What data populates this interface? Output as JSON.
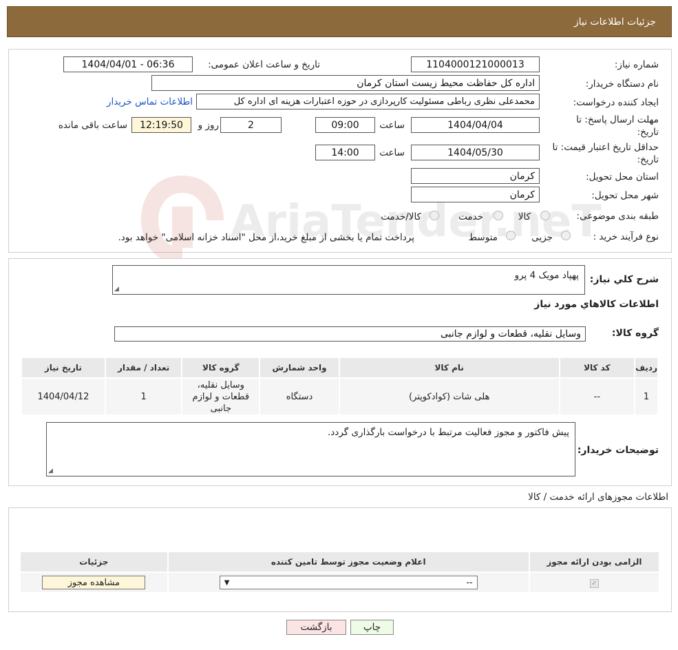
{
  "header": {
    "title": "جزئیات اطلاعات نیاز"
  },
  "form": {
    "need_number_label": "شماره نیاز:",
    "need_number": "1104000121000013",
    "announce_label": "تاریخ و ساعت اعلان عمومی:",
    "announce_value": "1404/04/01 - 06:36",
    "buyer_label": "نام دستگاه خریدار:",
    "buyer_value": "اداره کل حفاظت محیط زیست استان کرمان",
    "creator_label": "ایجاد کننده درخواست:",
    "creator_value": "محمدعلی نظری رباطی مسئولیت کارپردازی در حوزه اعتبارات هزینه ای اداره کل",
    "contact_link": "اطلاعات تماس خریدار",
    "deadline_label_1": "مهلت ارسال پاسخ: تا",
    "deadline_label_2": "تاریخ:",
    "deadline_date": "1404/04/04",
    "time_label": "ساعت",
    "deadline_time": "09:00",
    "days_value": "2",
    "days_label": "روز و",
    "remaining_time": "12:19:50",
    "remaining_label": "ساعت باقی مانده",
    "validity_label_1": "حداقل تاریخ اعتبار قیمت: تا",
    "validity_label_2": "تاریخ:",
    "validity_date": "1404/05/30",
    "validity_time": "14:00",
    "province_label": "استان محل تحویل:",
    "province_value": "کرمان",
    "city_label": "شهر محل تحویل:",
    "city_value": "کرمان",
    "category_label": "طبقه بندی موضوعی:",
    "category_options": [
      "کالا",
      "خدمت",
      "کالا/خدمت"
    ],
    "process_label": "نوع فرآیند خرید :",
    "process_options": [
      "جزیی",
      "متوسط"
    ],
    "process_note": "پرداخت تمام یا بخشی از مبلغ خرید،از محل \"اسناد خزانه اسلامی\" خواهد بود."
  },
  "details": {
    "summary_label": "شرح کلي نياز:",
    "summary_value": "پهپاد مویک 4 پرو",
    "goods_info_title": "اطلاعات کالاهاي مورد نياز",
    "goods_group_label": "گروه کالا:",
    "goods_group_value": "وسایل نقلیه، قطعات و لوازم جانبی",
    "table_headers": [
      "ردیف",
      "کد کالا",
      "نام کالا",
      "واحد شمارش",
      "گروه کالا",
      "تعداد / مقدار",
      "تاریخ نیاز"
    ],
    "table_rows": [
      {
        "row": "1",
        "code": "--",
        "name": "هلی شات (کوادکوپتر)",
        "unit": "دستگاه",
        "group": "وسایل نقلیه، قطعات و لوازم جانبی",
        "qty": "1",
        "date": "1404/04/12"
      }
    ],
    "buyer_notes_label": "توضیحات خریدار:",
    "buyer_notes_value": "پیش فاکتور و مجوز فعالیت مرتبط با درخواست بارگذاری گردد."
  },
  "permits": {
    "title": "اطلاعات مجوزهای ارائه خدمت / کالا",
    "headers": [
      "الزامی بودن ارائه مجوز",
      "اعلام وضعیت مجوز توسط تامین کننده",
      "جزئیات"
    ],
    "select_value": "--",
    "view_button": "مشاهده مجوز"
  },
  "footer": {
    "print_button": "چاپ",
    "back_button": "بازگشت"
  },
  "watermark": {
    "text": "AriaTender.neT"
  }
}
